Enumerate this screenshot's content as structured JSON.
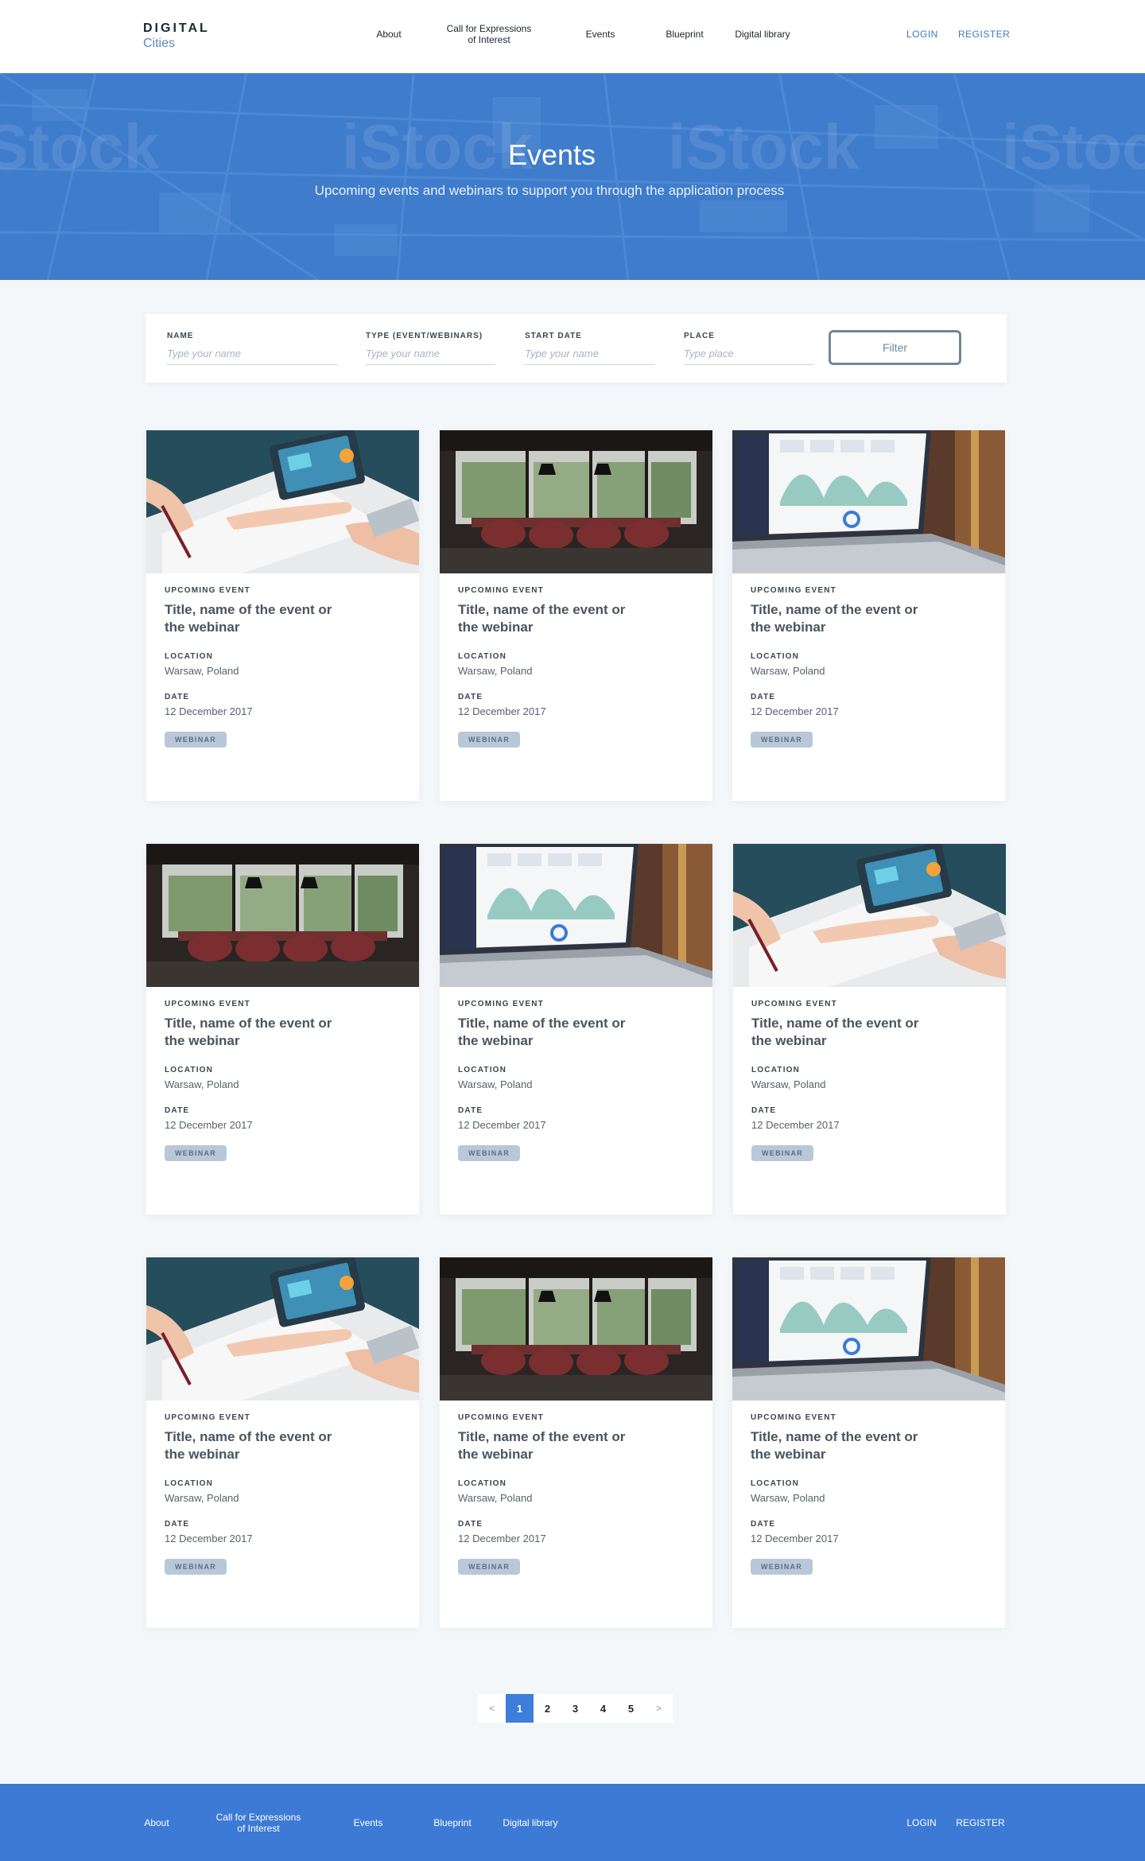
{
  "header": {
    "logo_top": "DIGITAL",
    "logo_bottom": "Cities",
    "nav": [
      {
        "label": "About"
      },
      {
        "label": "Call for Expressions of Interest"
      },
      {
        "label": "Events"
      },
      {
        "label": "Blueprint"
      },
      {
        "label": "Digital library"
      }
    ],
    "login": "LOGIN",
    "register": "REGISTER"
  },
  "hero": {
    "title": "Events",
    "subtitle": "Upcoming events and webinars to support you through the application process",
    "watermark": "iStock"
  },
  "filter": {
    "fields": [
      {
        "label": "NAME",
        "placeholder": "Type your name",
        "value": ""
      },
      {
        "label": "TYPE (EVENT/WEBINARS)",
        "placeholder": "Type your name",
        "value": ""
      },
      {
        "label": "START DATE",
        "placeholder": "Type your name",
        "value": ""
      },
      {
        "label": "PLACE",
        "placeholder": "Type place",
        "value": ""
      }
    ],
    "button": "Filter"
  },
  "cards": [
    {
      "image": "hands-tablet-photo",
      "eyebrow": "UPCOMING EVENT",
      "title": "Title, name of the event or the webinar",
      "location_label": "LOCATION",
      "location": "Warsaw, Poland",
      "date_label": "DATE",
      "date": "12 December 2017",
      "badge": "WEBINAR"
    },
    {
      "image": "conference-room-photo",
      "eyebrow": "UPCOMING EVENT",
      "title": "Title, name of the event or the webinar",
      "location_label": "LOCATION",
      "location": "Warsaw, Poland",
      "date_label": "DATE",
      "date": "12 December 2017",
      "badge": "WEBINAR"
    },
    {
      "image": "laptop-dashboard-photo",
      "eyebrow": "UPCOMING EVENT",
      "title": "Title, name of the event or the webinar",
      "location_label": "LOCATION",
      "location": "Warsaw, Poland",
      "date_label": "DATE",
      "date": "12 December 2017",
      "badge": "WEBINAR"
    },
    {
      "image": "conference-room-photo",
      "eyebrow": "UPCOMING EVENT",
      "title": "Title, name of the event or the webinar",
      "location_label": "LOCATION",
      "location": "Warsaw, Poland",
      "date_label": "DATE",
      "date": "12 December 2017",
      "badge": "WEBINAR"
    },
    {
      "image": "laptop-dashboard-photo",
      "eyebrow": "UPCOMING EVENT",
      "title": "Title, name of the event or the webinar",
      "location_label": "LOCATION",
      "location": "Warsaw, Poland",
      "date_label": "DATE",
      "date": "12 December 2017",
      "badge": "WEBINAR"
    },
    {
      "image": "hands-tablet-photo",
      "eyebrow": "UPCOMING EVENT",
      "title": "Title, name of the event or the webinar",
      "location_label": "LOCATION",
      "location": "Warsaw, Poland",
      "date_label": "DATE",
      "date": "12 December 2017",
      "badge": "WEBINAR"
    },
    {
      "image": "hands-tablet-photo",
      "eyebrow": "UPCOMING EVENT",
      "title": "Title, name of the event or the webinar",
      "location_label": "LOCATION",
      "location": "Warsaw, Poland",
      "date_label": "DATE",
      "date": "12 December 2017",
      "badge": "WEBINAR"
    },
    {
      "image": "conference-room-photo",
      "eyebrow": "UPCOMING EVENT",
      "title": "Title, name of the event or the webinar",
      "location_label": "LOCATION",
      "location": "Warsaw, Poland",
      "date_label": "DATE",
      "date": "12 December 2017",
      "badge": "WEBINAR"
    },
    {
      "image": "laptop-dashboard-photo",
      "eyebrow": "UPCOMING EVENT",
      "title": "Title, name of the event or the webinar",
      "location_label": "LOCATION",
      "location": "Warsaw, Poland",
      "date_label": "DATE",
      "date": "12 December 2017",
      "badge": "WEBINAR"
    }
  ],
  "pagination": {
    "prev": "<",
    "pages": [
      "1",
      "2",
      "3",
      "4",
      "5"
    ],
    "active": "1",
    "next": ">"
  },
  "footer": {
    "nav": [
      {
        "label": "About"
      },
      {
        "label": "Call for Expressions of Interest"
      },
      {
        "label": "Events"
      },
      {
        "label": "Blueprint"
      },
      {
        "label": "Digital library"
      }
    ],
    "login": "LOGIN",
    "register": "REGISTER"
  },
  "colors": {
    "brand_blue": "#3d7ad6",
    "hero_blue": "#3f7ccb",
    "badge_bg": "#b8c8d8",
    "page_bg": "#f4f7fa"
  }
}
